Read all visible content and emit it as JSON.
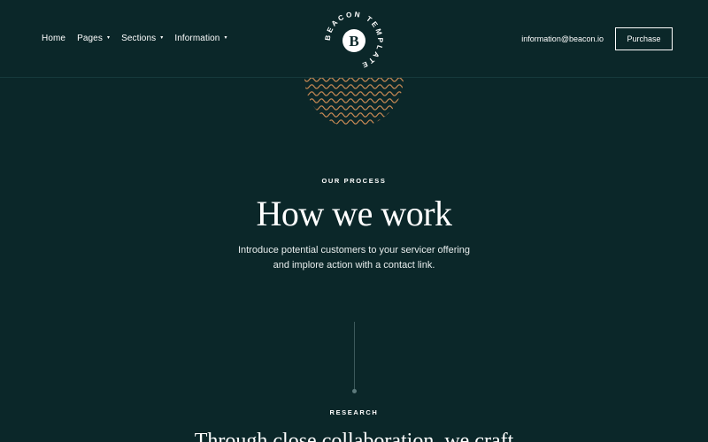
{
  "header": {
    "nav": [
      {
        "label": "Home",
        "has_dropdown": false
      },
      {
        "label": "Pages",
        "has_dropdown": true
      },
      {
        "label": "Sections",
        "has_dropdown": true
      },
      {
        "label": "Information",
        "has_dropdown": true
      }
    ],
    "logo": {
      "letter": "B",
      "ring_text": "BEACON TEMPLATE"
    },
    "email": "information@beacon.io",
    "purchase_label": "Purchase"
  },
  "process": {
    "eyebrow": "OUR PROCESS",
    "title": "How we work",
    "subtitle_line1": "Introduce potential customers to your servicer offering",
    "subtitle_line2": "and implore action with a contact link."
  },
  "research": {
    "eyebrow": "RESEARCH",
    "text": "Through close collaboration, we craft"
  },
  "colors": {
    "background": "#0b2729",
    "text": "#ffffff",
    "wave_accent": "#c98a55"
  }
}
